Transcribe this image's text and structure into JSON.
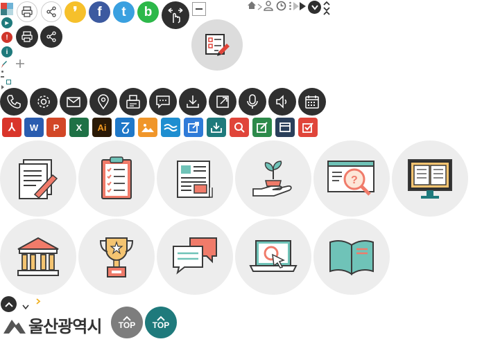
{
  "top_buttons": {
    "label_gray": "TOP",
    "label_teal": "TOP"
  },
  "logo": {
    "text": "울산광역시"
  },
  "share": {
    "kakao_letter": "❜",
    "facebook_letter": "f",
    "twitter_letter": "t",
    "band_letter": "b"
  },
  "apps": {
    "pdf": "⅄",
    "word": "W",
    "ppt": "P",
    "excel": "X",
    "ai": "Ai"
  },
  "colors": {
    "teal": "#1f7a7c",
    "dark": "#2f2f2f",
    "gray": "#7d7d7d",
    "coral": "#f07b6a",
    "mint": "#6fc3b8",
    "light_circle": "#ededed"
  }
}
